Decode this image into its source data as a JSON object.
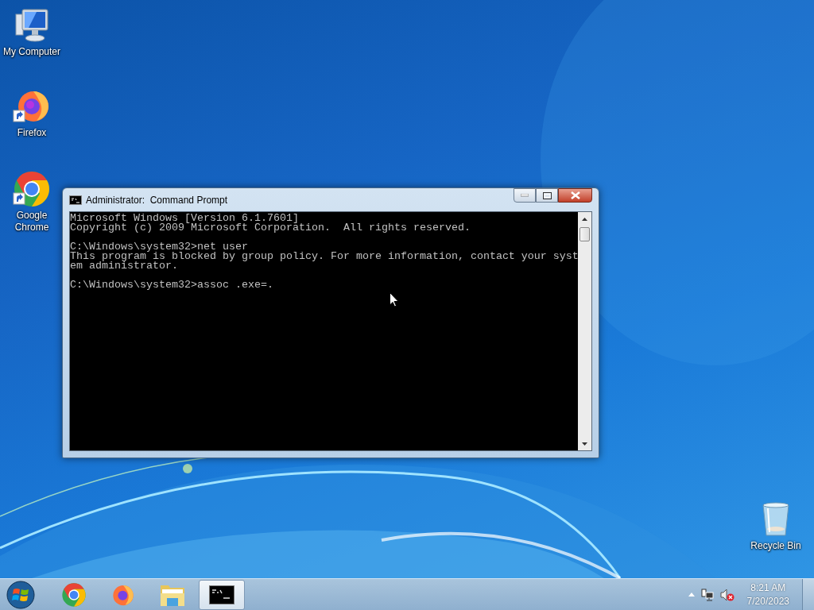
{
  "desktop_icons": [
    {
      "label": "My Computer",
      "kind": "computer",
      "shortcut": false
    },
    {
      "label": "Firefox",
      "kind": "firefox",
      "shortcut": true
    },
    {
      "label": "Google Chrome",
      "kind": "chrome",
      "shortcut": true
    },
    {
      "label": "Recycle Bin",
      "kind": "recycle-bin",
      "shortcut": false
    }
  ],
  "window": {
    "title": "Administrator:  Command Prompt",
    "active": true,
    "console_blocks": [
      [
        "Microsoft Windows [Version 6.1.7601]",
        "Copyright (c) 2009 Microsoft Corporation.  All rights reserved."
      ],
      [
        "C:\\Windows\\system32>net user",
        "This program is blocked by group policy. For more information, contact your syst",
        "em administrator."
      ],
      [
        "C:\\Windows\\system32>assoc .exe=."
      ]
    ]
  },
  "taskbar": {
    "items": [
      {
        "kind": "chrome",
        "selected": false
      },
      {
        "kind": "firefox",
        "selected": false
      },
      {
        "kind": "explorer",
        "selected": false
      },
      {
        "kind": "console",
        "selected": true
      }
    ],
    "tray": {
      "time": "8:21 AM",
      "date": "7/20/2023",
      "volume_muted": true
    }
  }
}
